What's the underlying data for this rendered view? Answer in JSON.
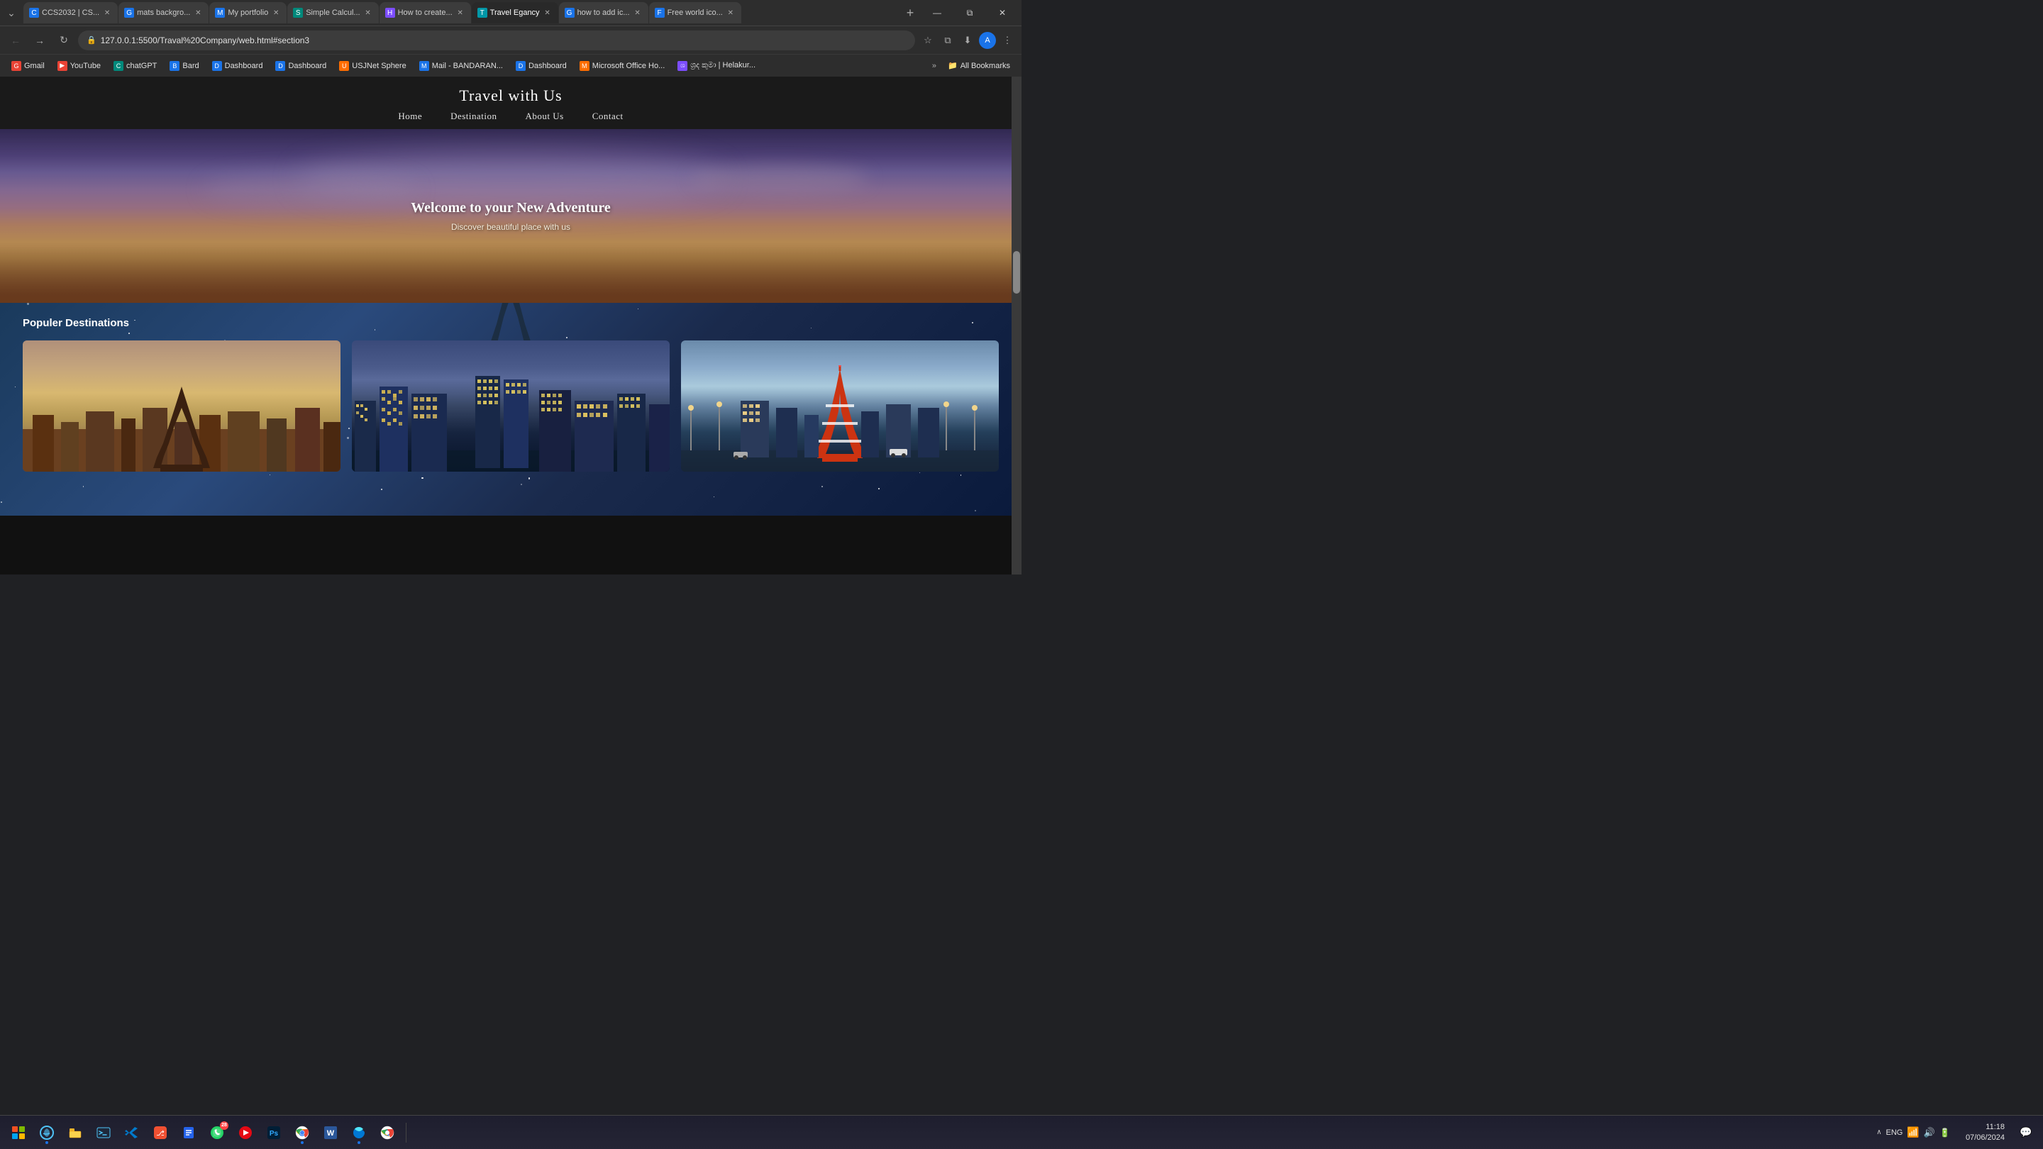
{
  "browser": {
    "tabs": [
      {
        "id": "tab1",
        "title": "CCS2032 | CS...",
        "active": false,
        "favicon_color": "fav-blue",
        "favicon_char": "C"
      },
      {
        "id": "tab2",
        "title": "mats backgro...",
        "active": false,
        "favicon_color": "fav-blue",
        "favicon_char": "G"
      },
      {
        "id": "tab3",
        "title": "My portfolio",
        "active": false,
        "favicon_color": "fav-blue",
        "favicon_char": "M"
      },
      {
        "id": "tab4",
        "title": "Simple Calcul...",
        "active": false,
        "favicon_color": "fav-teal",
        "favicon_char": "S"
      },
      {
        "id": "tab5",
        "title": "How to create...",
        "active": false,
        "favicon_color": "fav-purple",
        "favicon_char": "H"
      },
      {
        "id": "tab6",
        "title": "Travel Egancy",
        "active": true,
        "favicon_color": "fav-cyan",
        "favicon_char": "T"
      },
      {
        "id": "tab7",
        "title": "how to add ic...",
        "active": false,
        "favicon_color": "fav-blue",
        "favicon_char": "G"
      },
      {
        "id": "tab8",
        "title": "Free world ico...",
        "active": false,
        "favicon_color": "fav-blue",
        "favicon_char": "F"
      }
    ],
    "url": "127.0.0.1:5500/Traval%20Company/web.html#section3",
    "bookmarks": [
      {
        "label": "Gmail",
        "favicon_color": "fav-red",
        "favicon_char": "G"
      },
      {
        "label": "YouTube",
        "favicon_color": "fav-red",
        "favicon_char": "▶"
      },
      {
        "label": "chatGPT",
        "favicon_color": "fav-teal",
        "favicon_char": "C"
      },
      {
        "label": "Bard",
        "favicon_color": "fav-blue",
        "favicon_char": "B"
      },
      {
        "label": "Dashboard",
        "favicon_color": "fav-blue",
        "favicon_char": "D"
      },
      {
        "label": "Dashboard",
        "favicon_color": "fav-blue",
        "favicon_char": "D"
      },
      {
        "label": "USJNet Sphere",
        "favicon_color": "fav-orange",
        "favicon_char": "U"
      },
      {
        "label": "Mail - BANDARAN...",
        "favicon_color": "fav-blue",
        "favicon_char": "M"
      },
      {
        "label": "Dashboard",
        "favicon_color": "fav-blue",
        "favicon_char": "D"
      },
      {
        "label": "Microsoft Office Ho...",
        "favicon_color": "fav-orange",
        "favicon_char": "M"
      },
      {
        "label": "ශ්‍රද කුමා‍ | Helakur...",
        "favicon_color": "fav-purple",
        "favicon_char": "ශ"
      }
    ],
    "more_label": "»",
    "all_bookmarks_label": "All Bookmarks"
  },
  "website": {
    "title": "Travel with Us",
    "nav_links": [
      {
        "label": "Home"
      },
      {
        "label": "Destination"
      },
      {
        "label": "About Us"
      },
      {
        "label": "Contact"
      }
    ],
    "hero": {
      "heading": "Welcome to your New Adventure",
      "subheading": "Discover beautiful place with us"
    },
    "destinations": {
      "section_title": "Populer Destinations",
      "cards": [
        {
          "id": "paris",
          "alt": "Paris - Eiffel Tower"
        },
        {
          "id": "nyc",
          "alt": "New York City Skyline"
        },
        {
          "id": "tokyo",
          "alt": "Tokyo Tower"
        }
      ]
    }
  },
  "taskbar": {
    "time": "11:18",
    "date": "07/06/2024",
    "language": "ENG",
    "icons": [
      {
        "name": "windows-start",
        "label": "Start"
      },
      {
        "name": "file-explorer",
        "label": "File Explorer",
        "char": "📁"
      },
      {
        "name": "terminal",
        "label": "Terminal",
        "char": "⬡"
      },
      {
        "name": "vscode",
        "label": "VS Code",
        "char": "⬡"
      },
      {
        "name": "git",
        "label": "Git",
        "char": "⚙"
      },
      {
        "name": "todo",
        "label": "Todo",
        "char": "📋"
      },
      {
        "name": "whatsapp",
        "label": "WhatsApp",
        "char": "💬"
      },
      {
        "name": "music",
        "label": "Music",
        "char": "▶"
      },
      {
        "name": "photoshop",
        "label": "Photoshop",
        "char": "Ps"
      },
      {
        "name": "chrome",
        "label": "Chrome",
        "char": "●"
      },
      {
        "name": "word",
        "label": "Word",
        "char": "W"
      },
      {
        "name": "edge",
        "label": "Edge",
        "char": "e"
      },
      {
        "name": "chrome2",
        "label": "Chrome2",
        "char": "◎"
      }
    ]
  }
}
